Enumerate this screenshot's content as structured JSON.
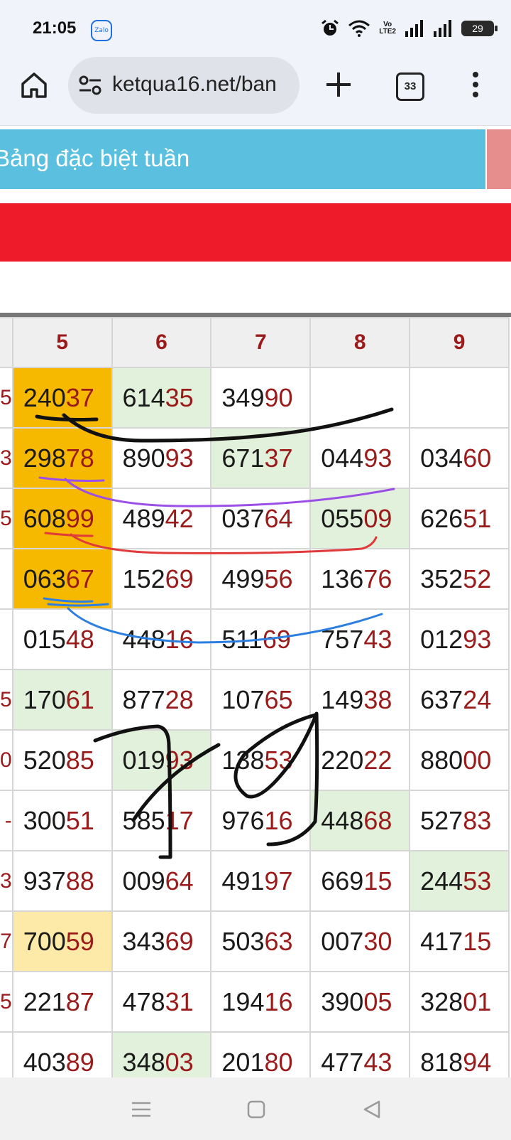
{
  "status_bar": {
    "time": "21:05",
    "app_icon": "Zalo",
    "lte_line1": "Vo",
    "lte_line2": "LTE2",
    "battery": "29"
  },
  "browser": {
    "url": "ketqua16.net/ban",
    "tab_count": "33"
  },
  "banner": {
    "title": "Bảng đặc biệt tuần"
  },
  "table": {
    "headers": [
      "5",
      "6",
      "7",
      "8",
      "9"
    ],
    "rows": [
      {
        "edge": "5",
        "cells": [
          {
            "lead": "240",
            "tail": "37",
            "bg": "orange"
          },
          {
            "lead": "614",
            "tail": "35",
            "bg": "green"
          },
          {
            "lead": "349",
            "tail": "90",
            "bg": ""
          },
          {
            "lead": "",
            "tail": "",
            "bg": ""
          },
          {
            "lead": "",
            "tail": "",
            "bg": ""
          }
        ]
      },
      {
        "edge": "3",
        "cells": [
          {
            "lead": "298",
            "tail": "78",
            "bg": "orange"
          },
          {
            "lead": "890",
            "tail": "93",
            "bg": ""
          },
          {
            "lead": "671",
            "tail": "37",
            "bg": "green"
          },
          {
            "lead": "044",
            "tail": "93",
            "bg": ""
          },
          {
            "lead": "034",
            "tail": "60",
            "bg": ""
          }
        ]
      },
      {
        "edge": "5",
        "cells": [
          {
            "lead": "608",
            "tail": "99",
            "bg": "orange"
          },
          {
            "lead": "489",
            "tail": "42",
            "bg": ""
          },
          {
            "lead": "037",
            "tail": "64",
            "bg": ""
          },
          {
            "lead": "055",
            "tail": "09",
            "bg": "green"
          },
          {
            "lead": "626",
            "tail": "51",
            "bg": ""
          }
        ]
      },
      {
        "edge": "",
        "cells": [
          {
            "lead": "063",
            "tail": "67",
            "bg": "orange"
          },
          {
            "lead": "152",
            "tail": "69",
            "bg": ""
          },
          {
            "lead": "499",
            "tail": "56",
            "bg": ""
          },
          {
            "lead": "136",
            "tail": "76",
            "bg": ""
          },
          {
            "lead": "352",
            "tail": "52",
            "bg": ""
          }
        ]
      },
      {
        "edge": "",
        "cells": [
          {
            "lead": "015",
            "tail": "48",
            "bg": ""
          },
          {
            "lead": "448",
            "tail": "16",
            "bg": ""
          },
          {
            "lead": "511",
            "tail": "69",
            "bg": ""
          },
          {
            "lead": "757",
            "tail": "43",
            "bg": ""
          },
          {
            "lead": "012",
            "tail": "93",
            "bg": ""
          }
        ]
      },
      {
        "edge": "5",
        "cells": [
          {
            "lead": "170",
            "tail": "61",
            "bg": "green"
          },
          {
            "lead": "877",
            "tail": "28",
            "bg": ""
          },
          {
            "lead": "107",
            "tail": "65",
            "bg": ""
          },
          {
            "lead": "149",
            "tail": "38",
            "bg": ""
          },
          {
            "lead": "637",
            "tail": "24",
            "bg": ""
          }
        ]
      },
      {
        "edge": "0",
        "cells": [
          {
            "lead": "520",
            "tail": "85",
            "bg": ""
          },
          {
            "lead": "019",
            "tail": "93",
            "bg": "green"
          },
          {
            "lead": "138",
            "tail": "53",
            "bg": ""
          },
          {
            "lead": "220",
            "tail": "22",
            "bg": ""
          },
          {
            "lead": "880",
            "tail": "00",
            "bg": ""
          }
        ]
      },
      {
        "edge": "-",
        "cells": [
          {
            "lead": "300",
            "tail": "51",
            "bg": ""
          },
          {
            "lead": "585",
            "tail": "17",
            "bg": ""
          },
          {
            "lead": "976",
            "tail": "16",
            "bg": ""
          },
          {
            "lead": "448",
            "tail": "68",
            "bg": "green"
          },
          {
            "lead": "527",
            "tail": "83",
            "bg": ""
          }
        ]
      },
      {
        "edge": "3",
        "cells": [
          {
            "lead": "937",
            "tail": "88",
            "bg": ""
          },
          {
            "lead": "009",
            "tail": "64",
            "bg": ""
          },
          {
            "lead": "491",
            "tail": "97",
            "bg": ""
          },
          {
            "lead": "669",
            "tail": "15",
            "bg": ""
          },
          {
            "lead": "244",
            "tail": "53",
            "bg": "green"
          }
        ]
      },
      {
        "edge": "7",
        "cells": [
          {
            "lead": "700",
            "tail": "59",
            "bg": "yellow"
          },
          {
            "lead": "343",
            "tail": "69",
            "bg": ""
          },
          {
            "lead": "503",
            "tail": "63",
            "bg": ""
          },
          {
            "lead": "007",
            "tail": "30",
            "bg": ""
          },
          {
            "lead": "417",
            "tail": "15",
            "bg": ""
          }
        ]
      },
      {
        "edge": "5",
        "cells": [
          {
            "lead": "221",
            "tail": "87",
            "bg": ""
          },
          {
            "lead": "478",
            "tail": "31",
            "bg": ""
          },
          {
            "lead": "194",
            "tail": "16",
            "bg": ""
          },
          {
            "lead": "390",
            "tail": "05",
            "bg": ""
          },
          {
            "lead": "328",
            "tail": "01",
            "bg": ""
          }
        ]
      },
      {
        "edge": "",
        "cells": [
          {
            "lead": "403",
            "tail": "89",
            "bg": ""
          },
          {
            "lead": "348",
            "tail": "03",
            "bg": "green"
          },
          {
            "lead": "201",
            "tail": "80",
            "bg": ""
          },
          {
            "lead": "477",
            "tail": "43",
            "bg": ""
          },
          {
            "lead": "818",
            "tail": "94",
            "bg": ""
          }
        ]
      }
    ]
  },
  "colors": {
    "orange": "#f7b800",
    "yellow": "#fde9a8",
    "green": "#e2f1db",
    "tail": "#9b1a1a",
    "banner_blue": "#5bbfe0",
    "banner_red": "#ee1c2a"
  }
}
